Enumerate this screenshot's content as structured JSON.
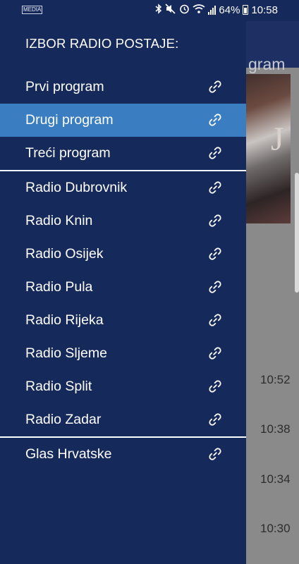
{
  "status_bar": {
    "left_badge": "MEDIA",
    "battery": "64%",
    "time": "10:58"
  },
  "background_app": {
    "title_fragment": "gram",
    "image_glyph": "J",
    "times": [
      "10:52",
      "10:38",
      "10:34",
      "10:30"
    ]
  },
  "drawer": {
    "header": "IZBOR RADIO POSTAJE:",
    "groups": [
      [
        "Prvi program",
        "Drugi program",
        "Treći program"
      ],
      [
        "Radio Dubrovnik",
        "Radio Knin",
        "Radio Osijek",
        "Radio Pula",
        "Radio Rijeka",
        "Radio Sljeme",
        "Radio Split",
        "Radio Zadar"
      ],
      [
        "Glas Hrvatske"
      ]
    ],
    "selected": "Drugi program",
    "item_icon": "link-icon"
  },
  "colors": {
    "drawer_bg": "#16295b",
    "selected_bg": "#3a7dc0",
    "text": "#ffffff"
  }
}
